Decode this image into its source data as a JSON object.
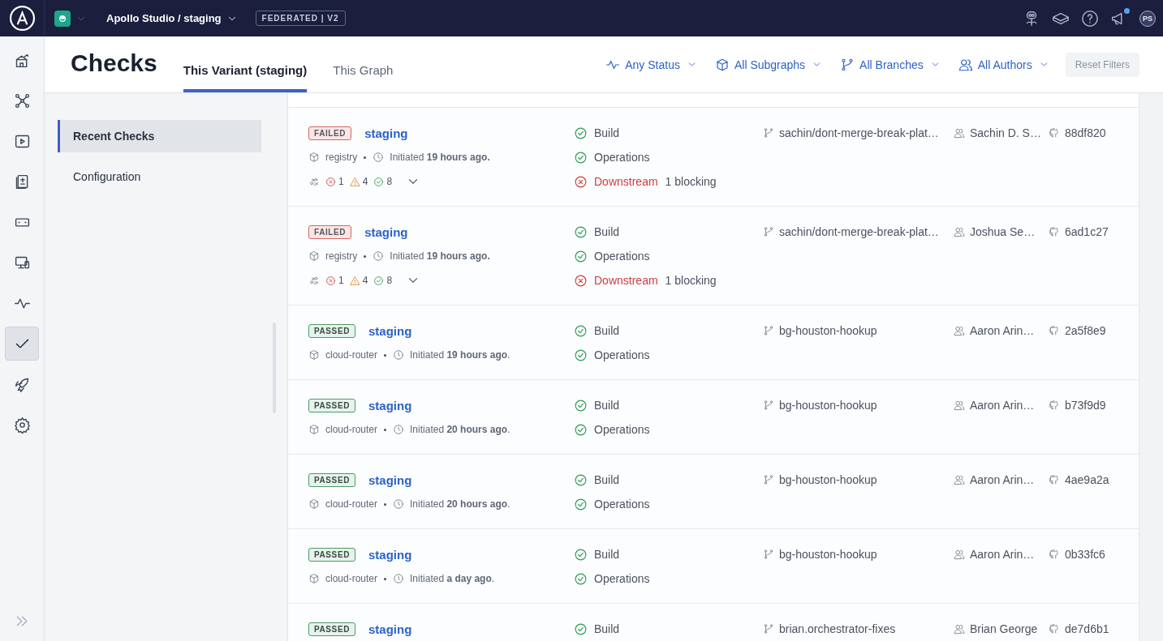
{
  "topbar": {
    "graph_name": "Apollo Studio / staging",
    "badge": "FEDERATED | V2",
    "avatar": "PS",
    "notification": true
  },
  "rail": [
    {
      "selected": false
    },
    {
      "selected": false
    },
    {
      "selected": false
    },
    {
      "selected": false
    },
    {
      "selected": false
    },
    {
      "selected": false
    },
    {
      "selected": false
    },
    {
      "selected": true
    },
    {
      "selected": false
    },
    {
      "selected": false
    }
  ],
  "header": {
    "title": "Checks",
    "tabs": [
      {
        "label": "This Variant (staging)",
        "selected": true
      },
      {
        "label": "This Graph",
        "selected": false
      }
    ],
    "filters": [
      {
        "label": "Any Status"
      },
      {
        "label": "All Subgraphs"
      },
      {
        "label": "All Branches"
      },
      {
        "label": "All Authors"
      }
    ],
    "reset": "Reset Filters"
  },
  "nav": [
    {
      "label": "Recent Checks",
      "selected": true
    },
    {
      "label": "Configuration",
      "selected": false
    }
  ],
  "rows": [
    {
      "status": {
        "kind": "failed",
        "label": "FAILED"
      },
      "variant": "staging",
      "subgraph": "registry",
      "initiated": "Initiated **19 hours ago.**",
      "counts": {
        "errors": "1",
        "warnings": "4",
        "passed": "8"
      },
      "checks": [
        {
          "kind": "passed",
          "label": "Build"
        },
        {
          "kind": "passed",
          "label": "Operations"
        },
        {
          "kind": "failed",
          "label": "Downstream",
          "note": "1 blocking"
        }
      ],
      "branch": "sachin/dont-merge-break-plat…",
      "author": "Sachin D. S…",
      "commit": "88df820"
    },
    {
      "status": {
        "kind": "failed",
        "label": "FAILED"
      },
      "variant": "staging",
      "subgraph": "registry",
      "initiated": "Initiated **19 hours ago.**",
      "counts": {
        "errors": "1",
        "warnings": "4",
        "passed": "8"
      },
      "checks": [
        {
          "kind": "passed",
          "label": "Build"
        },
        {
          "kind": "passed",
          "label": "Operations"
        },
        {
          "kind": "failed",
          "label": "Downstream",
          "note": "1 blocking"
        }
      ],
      "branch": "sachin/dont-merge-break-plat…",
      "author": "Joshua Se…",
      "commit": "6ad1c27"
    },
    {
      "status": {
        "kind": "passed",
        "label": "PASSED"
      },
      "variant": "staging",
      "subgraph": "cloud-router",
      "initiated": "Initiated **19 hours ago**.",
      "checks": [
        {
          "kind": "passed",
          "label": "Build"
        },
        {
          "kind": "passed",
          "label": "Operations"
        }
      ],
      "branch": "bg-houston-hookup",
      "author": "Aaron Arin…",
      "commit": "2a5f8e9"
    },
    {
      "status": {
        "kind": "passed",
        "label": "PASSED"
      },
      "variant": "staging",
      "subgraph": "cloud-router",
      "initiated": "Initiated **20 hours ago**.",
      "checks": [
        {
          "kind": "passed",
          "label": "Build"
        },
        {
          "kind": "passed",
          "label": "Operations"
        }
      ],
      "branch": "bg-houston-hookup",
      "author": "Aaron Arin…",
      "commit": "b73f9d9"
    },
    {
      "status": {
        "kind": "passed",
        "label": "PASSED"
      },
      "variant": "staging",
      "subgraph": "cloud-router",
      "initiated": "Initiated **20 hours ago**.",
      "checks": [
        {
          "kind": "passed",
          "label": "Build"
        },
        {
          "kind": "passed",
          "label": "Operations"
        }
      ],
      "branch": "bg-houston-hookup",
      "author": "Aaron Arin…",
      "commit": "4ae9a2a"
    },
    {
      "status": {
        "kind": "passed",
        "label": "PASSED"
      },
      "variant": "staging",
      "subgraph": "cloud-router",
      "initiated": "Initiated **a day ago**.",
      "checks": [
        {
          "kind": "passed",
          "label": "Build"
        },
        {
          "kind": "passed",
          "label": "Operations"
        }
      ],
      "branch": "bg-houston-hookup",
      "author": "Aaron Arin…",
      "commit": "0b33fc6"
    },
    {
      "status": {
        "kind": "passed",
        "label": "PASSED"
      },
      "variant": "staging",
      "checks": [
        {
          "kind": "passed",
          "label": "Build"
        }
      ],
      "branch": "brian.orchestrator-fixes",
      "author": "Brian George",
      "commit": "de7d6b1"
    }
  ]
}
